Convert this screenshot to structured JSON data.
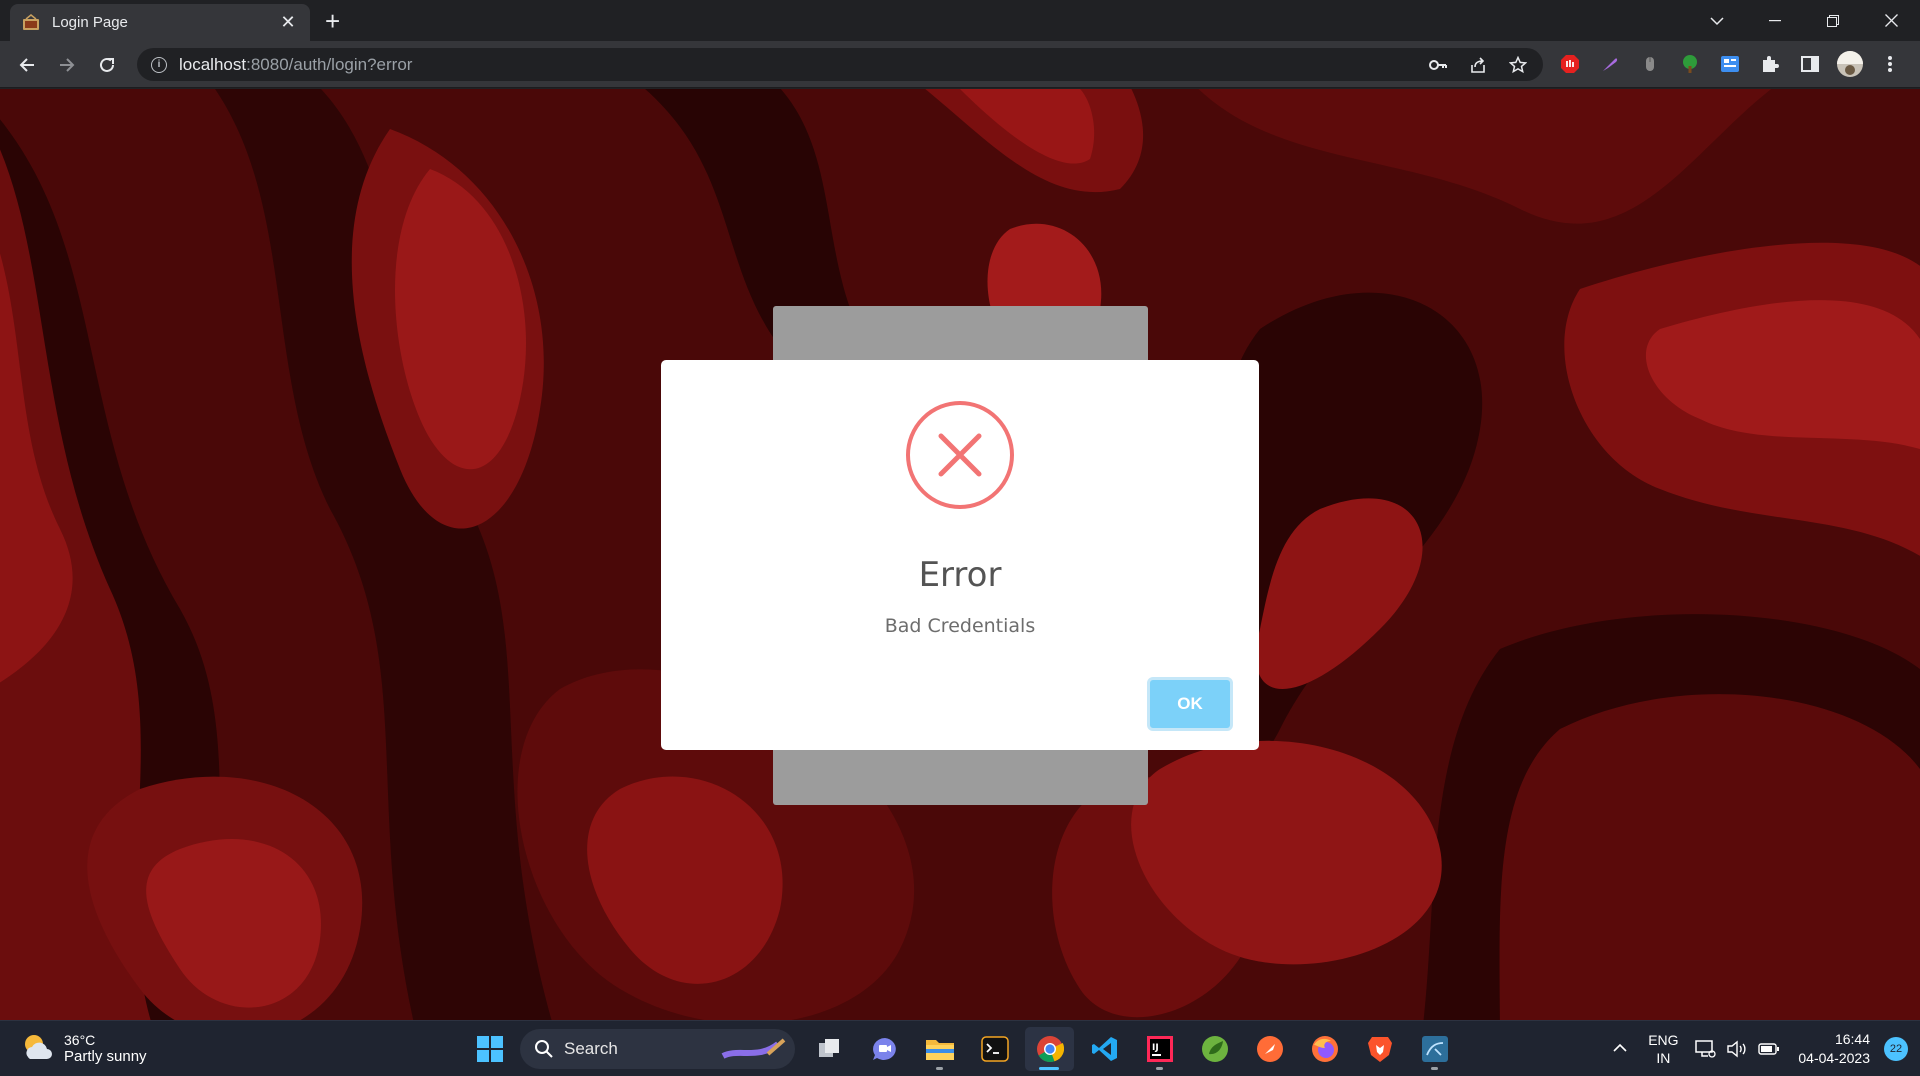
{
  "browser": {
    "tab_title": "Login Page",
    "url_host": "localhost",
    "url_path": ":8080/auth/login?error"
  },
  "modal": {
    "title": "Error",
    "message": "Bad Credentials",
    "ok_label": "OK",
    "icon": "error-x-circle",
    "accent_color": "#f27474",
    "button_color": "#7cd1f9"
  },
  "taskbar": {
    "weather_temp": "36°C",
    "weather_condition": "Partly sunny",
    "search_label": "Search",
    "lang_line1": "ENG",
    "lang_line2": "IN",
    "time": "16:44",
    "date": "04-04-2023",
    "notification_count": "22"
  }
}
